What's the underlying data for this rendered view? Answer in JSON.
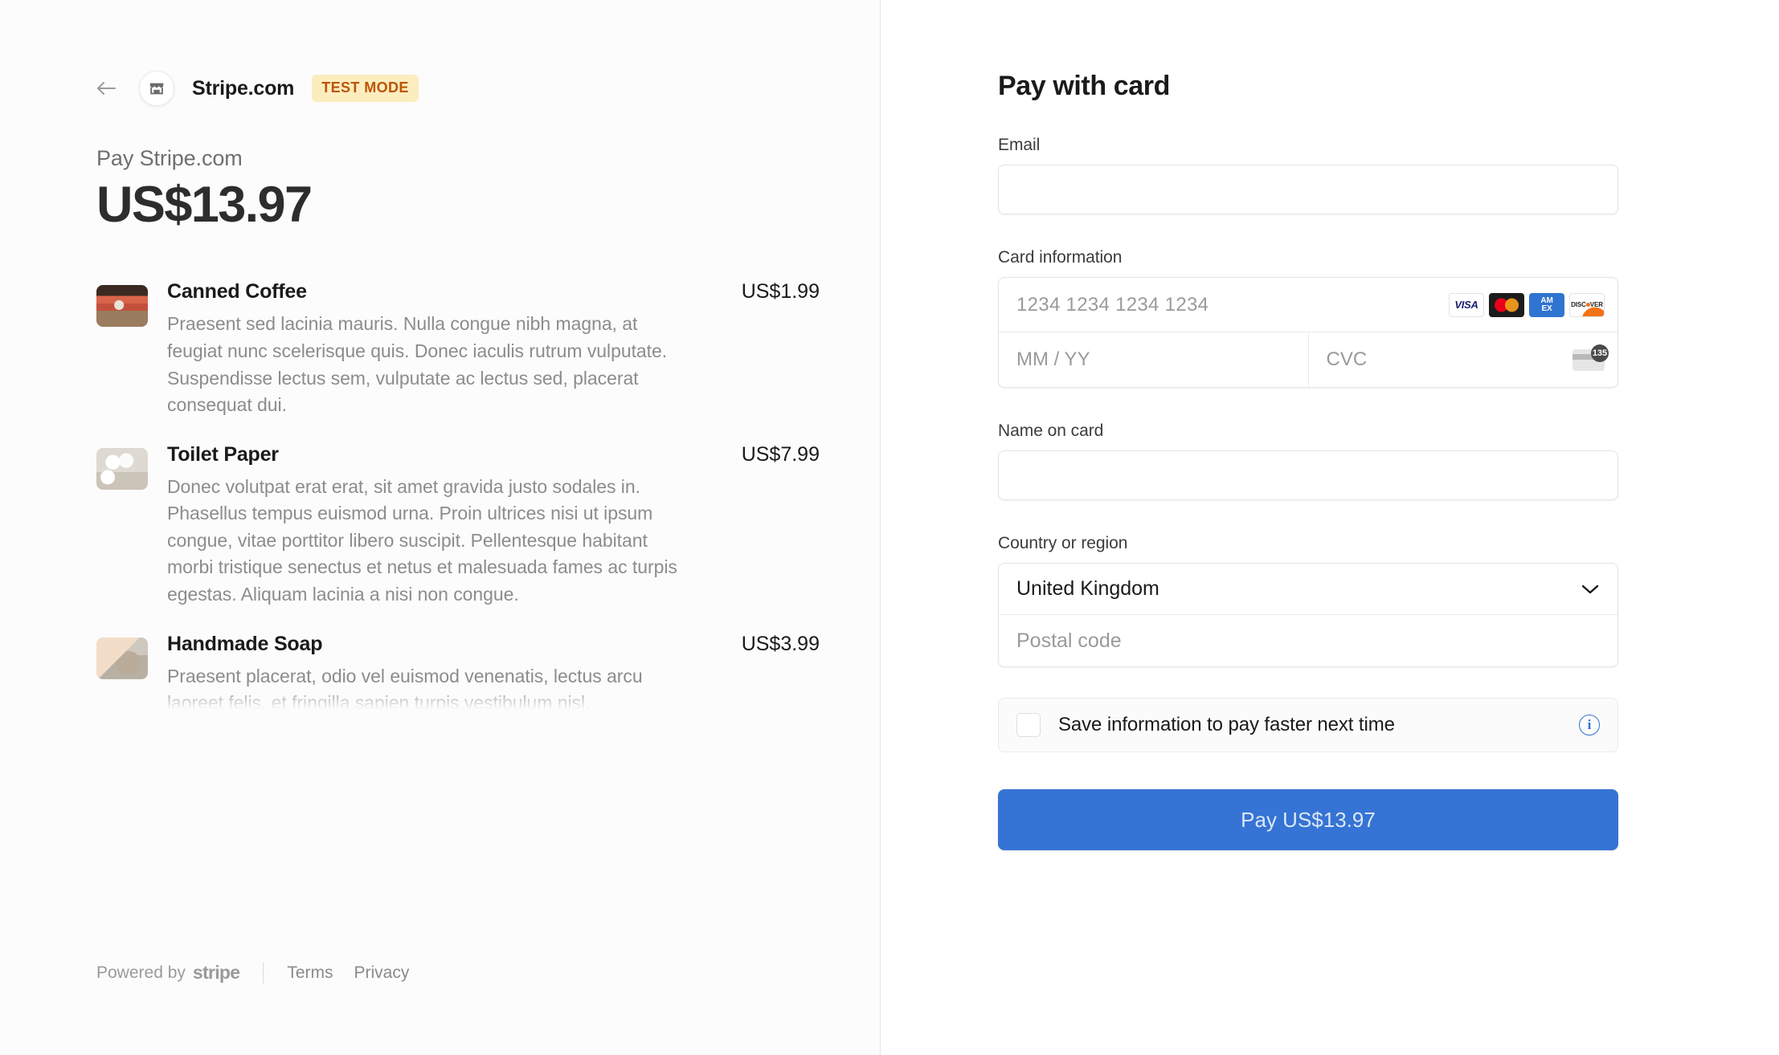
{
  "left": {
    "back_icon": "back-arrow-icon",
    "merchant_logo_icon": "storefront-icon",
    "merchant_name": "Stripe.com",
    "test_mode_badge": "TEST MODE",
    "pay_label": "Pay Stripe.com",
    "pay_amount": "US$13.97",
    "items": [
      {
        "name": "Canned Coffee",
        "price": "US$1.99",
        "description": "Praesent sed lacinia mauris. Nulla congue nibh magna, at feugiat nunc scelerisque quis. Donec iaculis rutrum vulputate. Suspendisse lectus sem, vulputate ac lectus sed, placerat consequat dui.",
        "thumbnail_icon": "canned-coffee-thumbnail"
      },
      {
        "name": "Toilet Paper",
        "price": "US$7.99",
        "description": "Donec volutpat erat erat, sit amet gravida justo sodales in. Phasellus tempus euismod urna. Proin ultrices nisi ut ipsum congue, vitae porttitor libero suscipit. Pellentesque habitant morbi tristique senectus et netus et malesuada fames ac turpis egestas. Aliquam lacinia a nisi non congue.",
        "thumbnail_icon": "toilet-paper-thumbnail"
      },
      {
        "name": "Handmade Soap",
        "price": "US$3.99",
        "description": "Praesent placerat, odio vel euismod venenatis, lectus arcu laoreet felis, et fringilla sapien turpis vestibulum nisl.",
        "thumbnail_icon": "handmade-soap-thumbnail"
      }
    ],
    "footer": {
      "powered_by": "Powered by",
      "stripe_wordmark": "stripe",
      "terms": "Terms",
      "privacy": "Privacy"
    }
  },
  "form": {
    "title": "Pay with card",
    "email_label": "Email",
    "email_value": "",
    "card_information_label": "Card information",
    "card_number_placeholder": "1234 1234 1234 1234",
    "expiry_placeholder": "MM / YY",
    "cvc_placeholder": "CVC",
    "cvc_badge_number": "135",
    "card_brands": [
      {
        "name": "visa-icon",
        "label": "VISA"
      },
      {
        "name": "mastercard-icon",
        "label": ""
      },
      {
        "name": "amex-icon",
        "label_top": "AM",
        "label_bottom": "EX"
      },
      {
        "name": "discover-icon",
        "label_a": "DISC",
        "label_b": "VER"
      }
    ],
    "name_on_card_label": "Name on card",
    "name_on_card_value": "",
    "country_label": "Country or region",
    "country_value": "United Kingdom",
    "chevron_icon": "chevron-down-icon",
    "postal_code_placeholder": "Postal code",
    "save_info_label": "Save information to pay faster next time",
    "save_info_checked": false,
    "info_icon": "info-circle-icon",
    "info_icon_glyph": "i",
    "pay_button_label": "Pay US$13.97"
  },
  "colors": {
    "accent_blue": "#3573d4",
    "test_badge_bg": "#fcedbf",
    "test_badge_text": "#bb5504",
    "panel_bg": "#fcfcfc"
  }
}
